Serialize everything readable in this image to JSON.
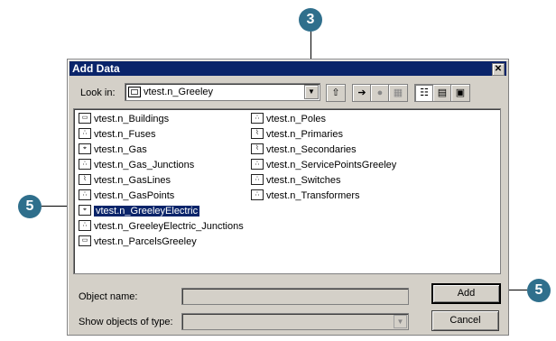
{
  "callouts": {
    "top": "3",
    "left": "5",
    "right": "5"
  },
  "dialog": {
    "title": "Add Data",
    "close_glyph": "✕",
    "look_in_label": "Look in:",
    "look_in_value": "vtest.n_Greeley",
    "toolbar": {
      "up_icon": "up-folder-icon",
      "connect_icon": "connect-folder-icon",
      "disconnect_icon": "disconnect-icon",
      "new_icon": "new-item-icon",
      "list_icon": "list-view-icon",
      "details_icon": "details-view-icon",
      "thumbs_icon": "thumbnails-view-icon"
    },
    "items_left": [
      {
        "label": "vtest.n_Buildings",
        "icon": "polygon-featureclass-icon"
      },
      {
        "label": "vtest.n_Fuses",
        "icon": "point-featureclass-icon"
      },
      {
        "label": "vtest.n_Gas",
        "icon": "network-dataset-icon"
      },
      {
        "label": "vtest.n_Gas_Junctions",
        "icon": "point-featureclass-icon"
      },
      {
        "label": "vtest.n_GasLines",
        "icon": "line-featureclass-icon"
      },
      {
        "label": "vtest.n_GasPoints",
        "icon": "point-featureclass-icon"
      },
      {
        "label": "vtest.n_GreeleyElectric",
        "icon": "network-dataset-icon",
        "selected": true
      },
      {
        "label": "vtest.n_GreeleyElectric_Junctions",
        "icon": "point-featureclass-icon"
      },
      {
        "label": "vtest.n_ParcelsGreeley",
        "icon": "polygon-featureclass-icon"
      }
    ],
    "items_right": [
      {
        "label": "vtest.n_Poles",
        "icon": "point-featureclass-icon"
      },
      {
        "label": "vtest.n_Primaries",
        "icon": "line-featureclass-icon"
      },
      {
        "label": "vtest.n_Secondaries",
        "icon": "line-featureclass-icon"
      },
      {
        "label": "vtest.n_ServicePointsGreeley",
        "icon": "point-featureclass-icon"
      },
      {
        "label": "vtest.n_Switches",
        "icon": "point-featureclass-icon"
      },
      {
        "label": "vtest.n_Transformers",
        "icon": "point-featureclass-icon"
      }
    ],
    "object_name_label": "Object name:",
    "object_name_value": "",
    "show_type_label": "Show objects of type:",
    "show_type_value": "",
    "add_label": "Add",
    "cancel_label": "Cancel"
  }
}
